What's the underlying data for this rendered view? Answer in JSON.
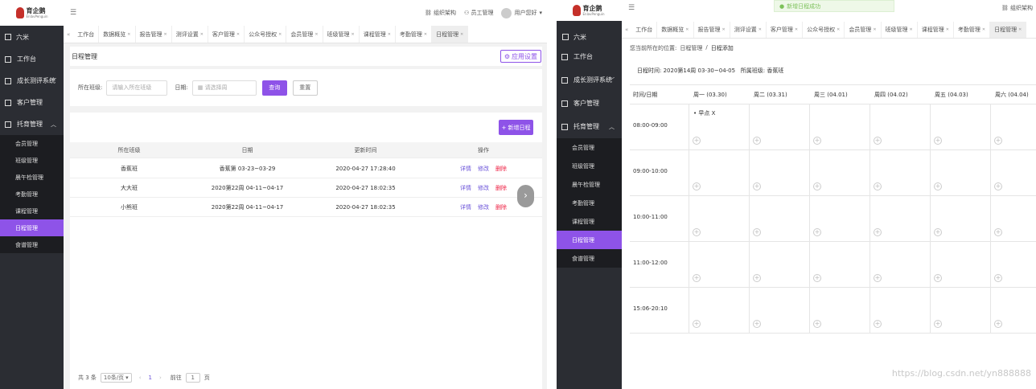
{
  "left": {
    "logo": {
      "title": "育企鹅",
      "subtitle": "EnlavPenguin"
    },
    "sidebar": {
      "user": "六米",
      "menus": [
        {
          "label": "工作台",
          "arrow": ""
        },
        {
          "label": "成长测评系统",
          "arrow": "﹀"
        },
        {
          "label": "客户管理",
          "arrow": ""
        },
        {
          "label": "托育管理",
          "arrow": "︿"
        }
      ],
      "submenu": [
        "会员管理",
        "班级管理",
        "晨午检管理",
        "考勤管理",
        "课程管理",
        "日程管理",
        "食谱管理"
      ],
      "active": "日程管理"
    },
    "topbar": {
      "menu_icon": "☰",
      "org": "组织架构",
      "staff": "员工管理",
      "user": "用户您好"
    },
    "tabs": [
      "工作台",
      "数据概览",
      "报告管理",
      "测评设置",
      "客户管理",
      "公众号授权",
      "会员管理",
      "班级管理",
      "课程管理",
      "考勤管理",
      "日程管理"
    ],
    "page_title": "日程管理",
    "settings_btn": "应用设置",
    "filter": {
      "class_label": "所在班级:",
      "class_placeholder": "请输入所在班级",
      "date_label": "日期:",
      "date_placeholder": "请选择周",
      "query_btn": "查询",
      "reset_btn": "重置"
    },
    "add_btn": "+ 新增日程",
    "table": {
      "headers": [
        "所在班级",
        "日期",
        "更新时间",
        "操作"
      ],
      "rows": [
        {
          "class": "香蕉班",
          "date": "香蕉第 03-23~03-29",
          "updated": "2020-04-27 17:28:40"
        },
        {
          "class": "大大班",
          "date": "2020第22周 04-11~04-17",
          "updated": "2020-04-27 18:02:35"
        },
        {
          "class": "小熊班",
          "date": "2020第22周 04-11~04-17",
          "updated": "2020-04-27 18:02:35"
        }
      ],
      "actions": [
        "详情",
        "修改",
        "删除"
      ]
    },
    "pager": {
      "total": "共 3 条",
      "size": "10条/页",
      "page": "1",
      "goto_label": "前往",
      "goto_value": "1",
      "page_suffix": "页"
    }
  },
  "right": {
    "logo": {
      "title": "育企鹅",
      "subtitle": "EnlavPenguin"
    },
    "toast": "新增日程成功",
    "org": "组织架构",
    "tabs": [
      "工作台",
      "数据概览",
      "报告管理",
      "测评设置",
      "客户管理",
      "公众号授权",
      "会员管理",
      "班级管理",
      "课程管理",
      "考勤管理",
      "日程管理"
    ],
    "breadcrumb": {
      "prefix": "您当前所在的位置:",
      "parent": "日程管理",
      "sep": "/",
      "current": "日程添加"
    },
    "info": "日程时间: 2020第14周 03-30~04-05   所属班级: 香蕉班",
    "calendar": {
      "corner": "时间/日期",
      "days": [
        "周一 (03.30)",
        "周二 (03.31)",
        "周三 (04.01)",
        "周四 (04.02)",
        "周五 (04.03)",
        "周六 (04.04)"
      ],
      "times": [
        "08:00-09:00",
        "09:00-10:00",
        "10:00-11:00",
        "11:00-12:00",
        "15:06-20:10"
      ],
      "event": {
        "label": "• 早点",
        "close": "X"
      }
    },
    "watermark": "https://blog.csdn.net/yn888888"
  }
}
